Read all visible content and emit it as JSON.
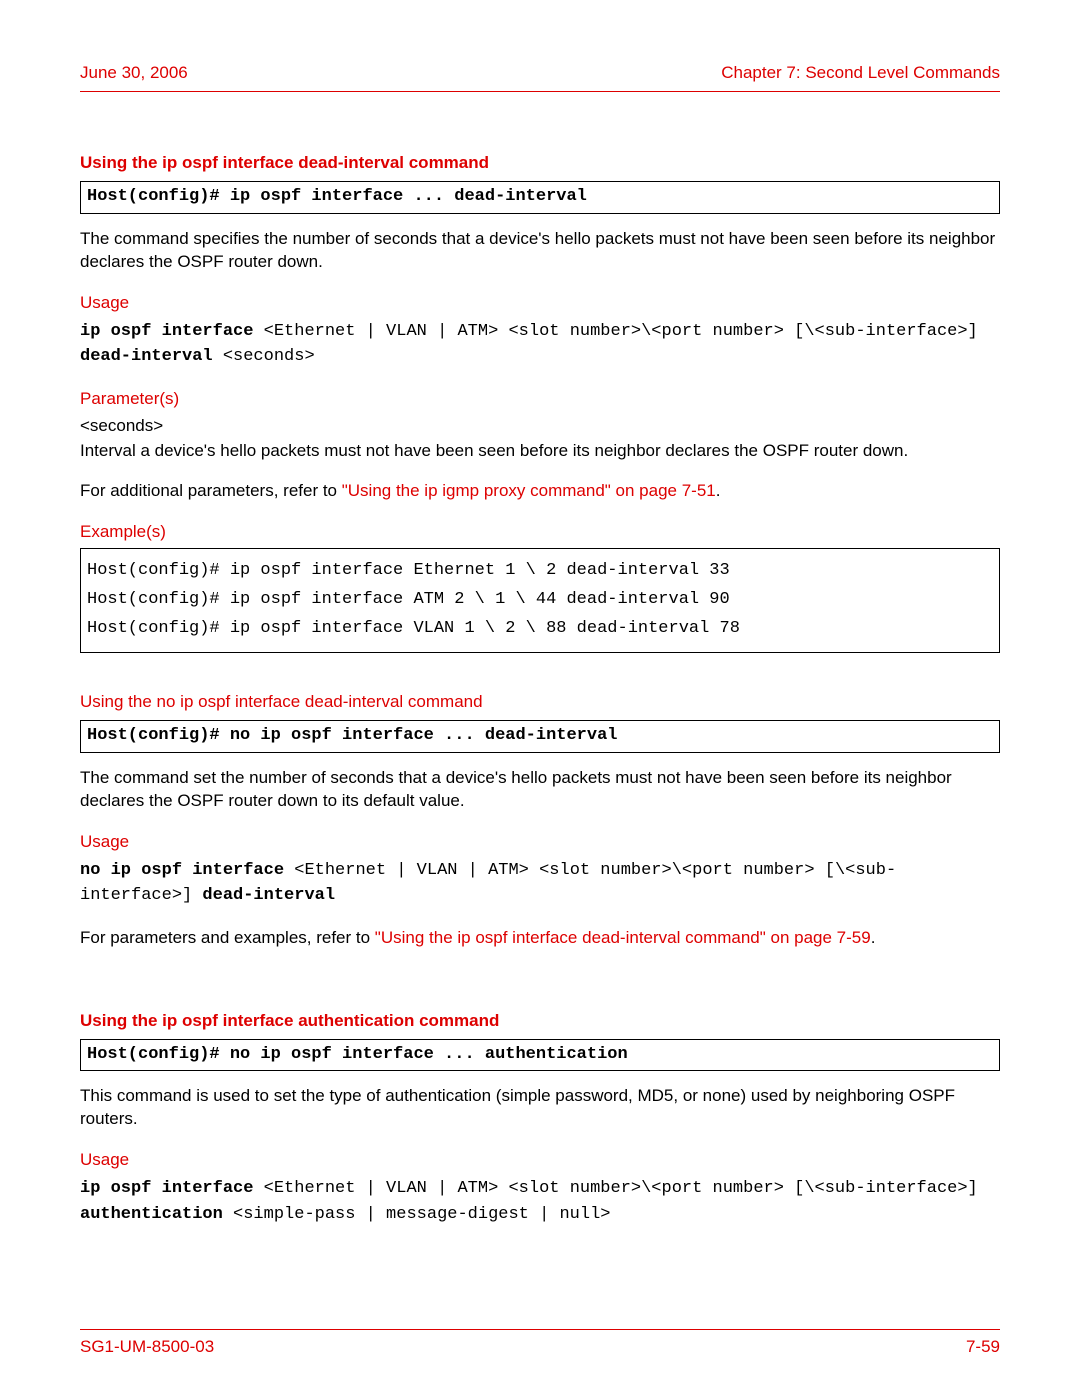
{
  "header": {
    "date": "June 30, 2006",
    "chapter": "Chapter 7: Second Level Commands"
  },
  "section1": {
    "title": "Using the ip ospf interface dead-interval command",
    "cmd": "Host(config)# ip ospf interface ... dead-interval",
    "desc": "The command specifies the number of seconds that a device's hello packets must not have been seen before its neighbor declares the OSPF router down.",
    "usage_label": "Usage",
    "usage_b1": "ip ospf interface ",
    "usage_p1": "<Ethernet | VLAN | ATM> <slot number>\\<port number> [\\<sub-interface>] ",
    "usage_b2": "dead-interval ",
    "usage_p2": "<seconds>",
    "params_label": "Parameter(s)",
    "param_name": "<seconds>",
    "param_desc": "Interval a device's hello packets must not have been seen before its neighbor declares the OSPF router down.",
    "refer_pre": "For additional parameters, refer to ",
    "refer_link": "\"Using the ip igmp proxy command\" on page 7-51",
    "refer_post": ".",
    "examples_label": "Example(s)",
    "examples": "Host(config)# ip ospf interface Ethernet 1 \\ 2 dead-interval 33\nHost(config)# ip ospf interface ATM 2 \\ 1 \\ 44 dead-interval 90\nHost(config)# ip ospf interface VLAN 1 \\ 2 \\ 88 dead-interval 78"
  },
  "section2": {
    "title": "Using the no ip ospf interface dead-interval command",
    "cmd": "Host(config)# no ip ospf interface ... dead-interval",
    "desc": "The command set the number of seconds that a device's hello packets must not have been seen before its neighbor declares the OSPF router down to its default value.",
    "usage_label": "Usage",
    "usage_b1": "no ip ospf interface ",
    "usage_p1": "<Ethernet | VLAN | ATM> <slot number>\\<port number> [\\<sub-interface>] ",
    "usage_b2": "dead-interval",
    "refer_pre": "For parameters and examples, refer to ",
    "refer_link": "\"Using the ip ospf interface dead-interval command\" on page 7-59",
    "refer_post": "."
  },
  "section3": {
    "title": "Using the ip ospf interface authentication command",
    "cmd": "Host(config)# no ip ospf interface ... authentication",
    "desc": "This command is used to set the type of authentication (simple password, MD5, or none) used by neighboring OSPF routers.",
    "usage_label": "Usage",
    "usage_b1": "ip ospf interface ",
    "usage_p1": "<Ethernet | VLAN | ATM> <slot number>\\<port number> [\\<sub-interface>] ",
    "usage_b2": "authentication ",
    "usage_p2": "<simple-pass | message-digest | null>"
  },
  "footer": {
    "doc": "SG1-UM-8500-03",
    "page": "7-59"
  }
}
